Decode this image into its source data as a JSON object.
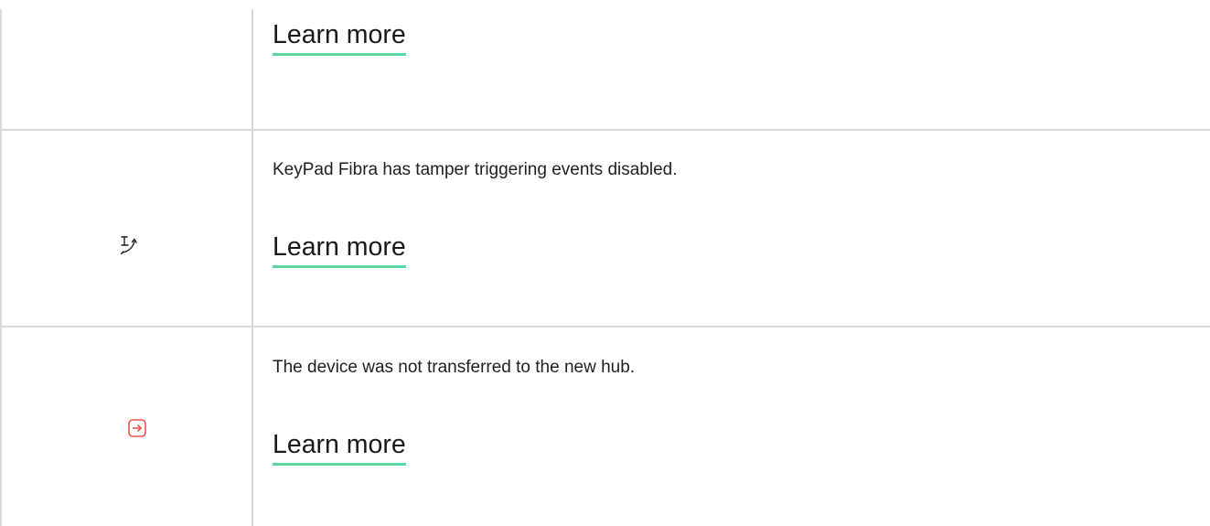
{
  "rows": [
    {
      "icon": "",
      "description": "",
      "link_label": "Learn more"
    },
    {
      "icon": "tamper-icon",
      "description": "KeyPad Fibra has tamper triggering events disabled.",
      "link_label": "Learn more"
    },
    {
      "icon": "transfer-icon",
      "description": "The device was not transferred to the new hub.",
      "link_label": "Learn more"
    }
  ],
  "colors": {
    "link_underline": "#5ad6a2",
    "transfer_icon": "#e2574c",
    "divider": "#d9d9d9",
    "text": "#1f1f1f"
  }
}
